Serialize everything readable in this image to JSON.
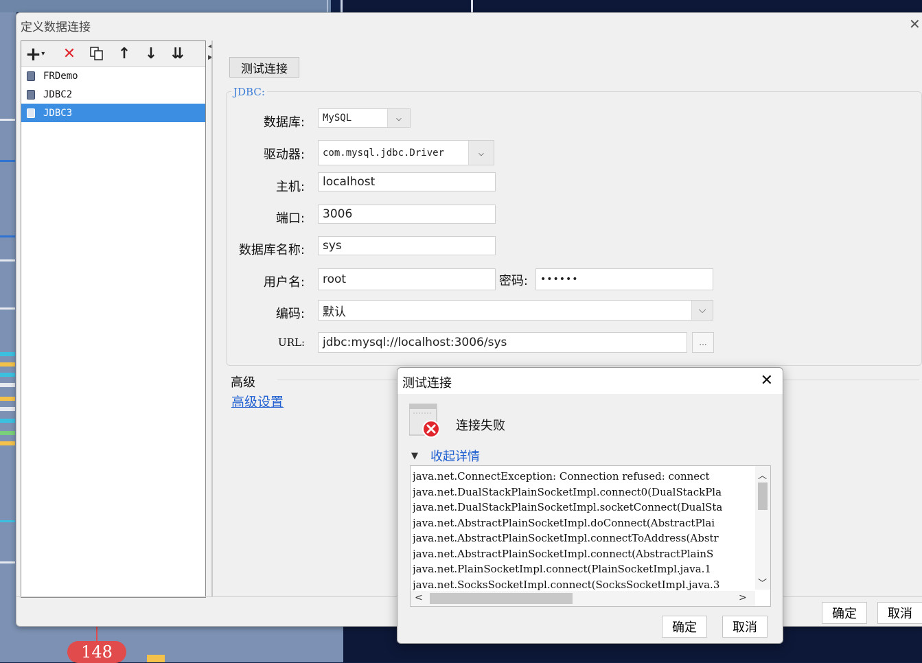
{
  "background": {
    "badge": "148"
  },
  "main_dialog": {
    "title": "定义数据连接",
    "toolbar": {
      "add": "+",
      "add_caret": "▾",
      "delete": "✕",
      "copy": "⧉",
      "move_up": "↑",
      "move_down": "↓",
      "sort": "⇊"
    },
    "connections": [
      {
        "name": "FRDemo"
      },
      {
        "name": "JDBC2"
      },
      {
        "name": "JDBC3",
        "selected": true
      }
    ],
    "test_button": "测试连接",
    "jdbc_legend": "JDBC:",
    "form": {
      "database_label": "数据库:",
      "database_value": "MySQL",
      "driver_label": "驱动器:",
      "driver_value": "com.mysql.jdbc.Driver",
      "host_label": "主机:",
      "host_value": "localhost",
      "port_label": "端口:",
      "port_value": "3006",
      "dbname_label": "数据库名称:",
      "dbname_value": "sys",
      "user_label": "用户名:",
      "user_value": "root",
      "password_label": "密码:",
      "password_value": "••••••",
      "encoding_label": "编码:",
      "encoding_value": "默认",
      "url_label": "URL:",
      "url_value": "jdbc:mysql://localhost:3006/sys",
      "url_button": "..."
    },
    "advanced_label": "高级",
    "advanced_link": "高级设置",
    "ok": "确定",
    "cancel": "取消"
  },
  "test_dialog": {
    "title": "测试连接",
    "message": "连接失败",
    "toggle": "收起详情",
    "details": [
      "java.net.ConnectException: Connection refused: connect",
      "java.net.DualStackPlainSocketImpl.connect0(DualStackPla",
      "java.net.DualStackPlainSocketImpl.socketConnect(DualSta",
      "java.net.AbstractPlainSocketImpl.doConnect(AbstractPlai",
      "java.net.AbstractPlainSocketImpl.connectToAddress(Abstr",
      "java.net.AbstractPlainSocketImpl.connect(AbstractPlainS",
      "java.net.PlainSocketImpl.connect(PlainSocketImpl.java.1",
      "java.net.SocksSocketImpl.connect(SocksSocketImpl.java.3"
    ],
    "ok": "确定",
    "cancel": "取消"
  },
  "colors": {
    "selection": "#3c8ee3",
    "link": "#1f5fd1",
    "error": "#e0262c"
  }
}
